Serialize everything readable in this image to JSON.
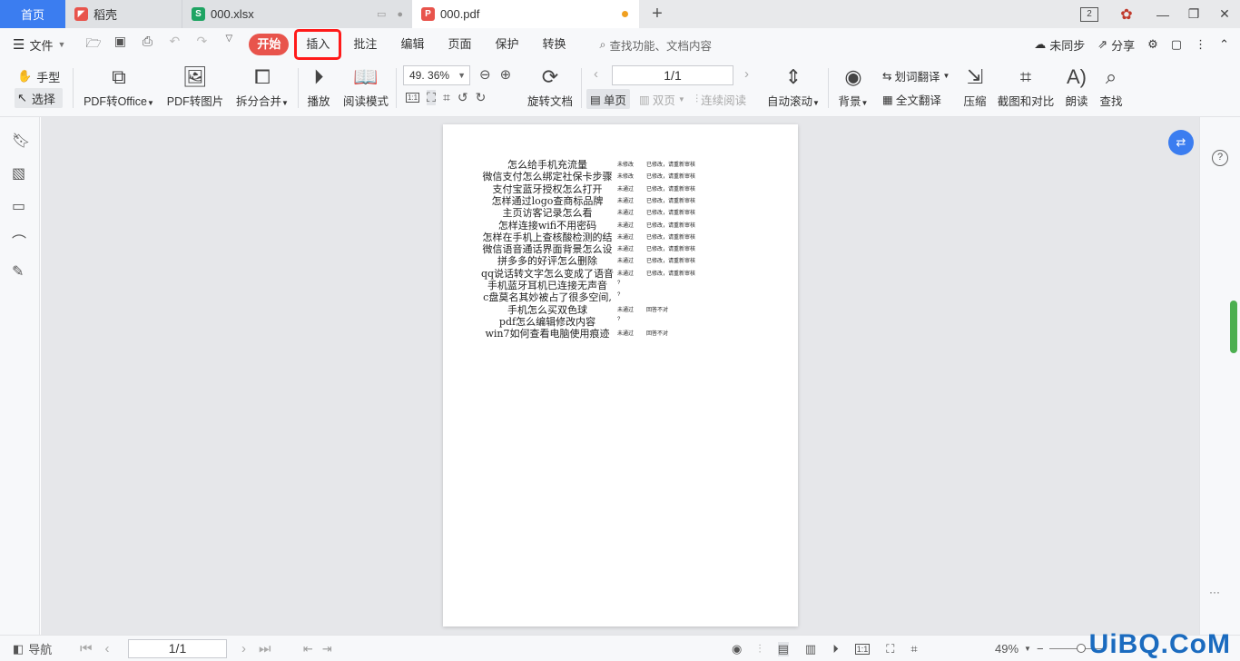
{
  "tabs": {
    "home": "首页",
    "daoke": "稻壳",
    "xlsx": "000.xlsx",
    "pdf": "000.pdf",
    "add": "+"
  },
  "window": {
    "badge": "2"
  },
  "menubar": {
    "file": "文件",
    "tabs": [
      "开始",
      "插入",
      "批注",
      "编辑",
      "页面",
      "保护",
      "转换"
    ],
    "search_placeholder": "查找功能、文档内容",
    "unsync": "未同步",
    "share": "分享"
  },
  "toolbar": {
    "hand": "手型",
    "select": "选择",
    "pdf_to_office": "PDF转Office",
    "pdf_to_image": "PDF转图片",
    "split_merge": "拆分合并",
    "play": "播放",
    "read_mode": "阅读模式",
    "zoom": "49. 36%",
    "page_value": "1/1",
    "rotate_doc": "旋转文档",
    "single_page": "单页",
    "double_page": "双页",
    "continuous": "连续阅读",
    "auto_scroll": "自动滚动",
    "background": "背景",
    "word_translate": "划词翻译",
    "full_translate": "全文翻译",
    "compress": "压缩",
    "screenshot_compare": "截图和对比",
    "read_aloud": "朗读",
    "find": "查找"
  },
  "document": {
    "rows": [
      {
        "q": "怎么给手机充流量",
        "s": "未修改",
        "n": "已修改，请重新审核"
      },
      {
        "q": "微信支付怎么绑定社保卡步骤",
        "s": "未修改",
        "n": "已修改，请重新审核"
      },
      {
        "q": "支付宝蓝牙授权怎么打开",
        "s": "未通过",
        "n": "已修改，请重新审核"
      },
      {
        "q": "怎样通过logo查商标品牌",
        "s": "未通过",
        "n": "已修改，请重新审核"
      },
      {
        "q": "主页访客记录怎么看",
        "s": "未通过",
        "n": "已修改，请重新审核"
      },
      {
        "q": "怎样连接wifi不用密码",
        "s": "未通过",
        "n": "已修改，请重新审核"
      },
      {
        "q": "怎样在手机上查核酸检测的结",
        "s": "未通过",
        "n": "已修改，请重新审核"
      },
      {
        "q": "微信语音通话界面背景怎么设",
        "s": "未通过",
        "n": "已修改，请重新审核"
      },
      {
        "q": "拼多多的好评怎么删除",
        "s": "未通过",
        "n": "已修改，请重新审核"
      },
      {
        "q": "qq说话转文字怎么变成了语音",
        "s": "未通过",
        "n": "已修改，请重新审核"
      },
      {
        "q": "手机蓝牙耳机已连接无声音",
        "s": "?",
        "n": ""
      },
      {
        "q": "c盘莫名其妙被占了很多空间,",
        "s": "?",
        "n": ""
      },
      {
        "q": "手机怎么买双色球",
        "s": "未通过",
        "n": "回答不对"
      },
      {
        "q": "pdf怎么编辑修改内容",
        "s": "?",
        "n": ""
      },
      {
        "q": "win7如何查看电脑使用痕迹",
        "s": "未通过",
        "n": "回答不对"
      }
    ]
  },
  "statusbar": {
    "nav": "导航",
    "page_value": "1/1",
    "zoom": "49%",
    "watermark": "UiBQ.CoM"
  },
  "colors": {
    "accent": "#3b7df0",
    "start_tab": "#e8544c",
    "highlight_border": "#ff1a1a",
    "scroll_thumb": "#4caf50"
  }
}
